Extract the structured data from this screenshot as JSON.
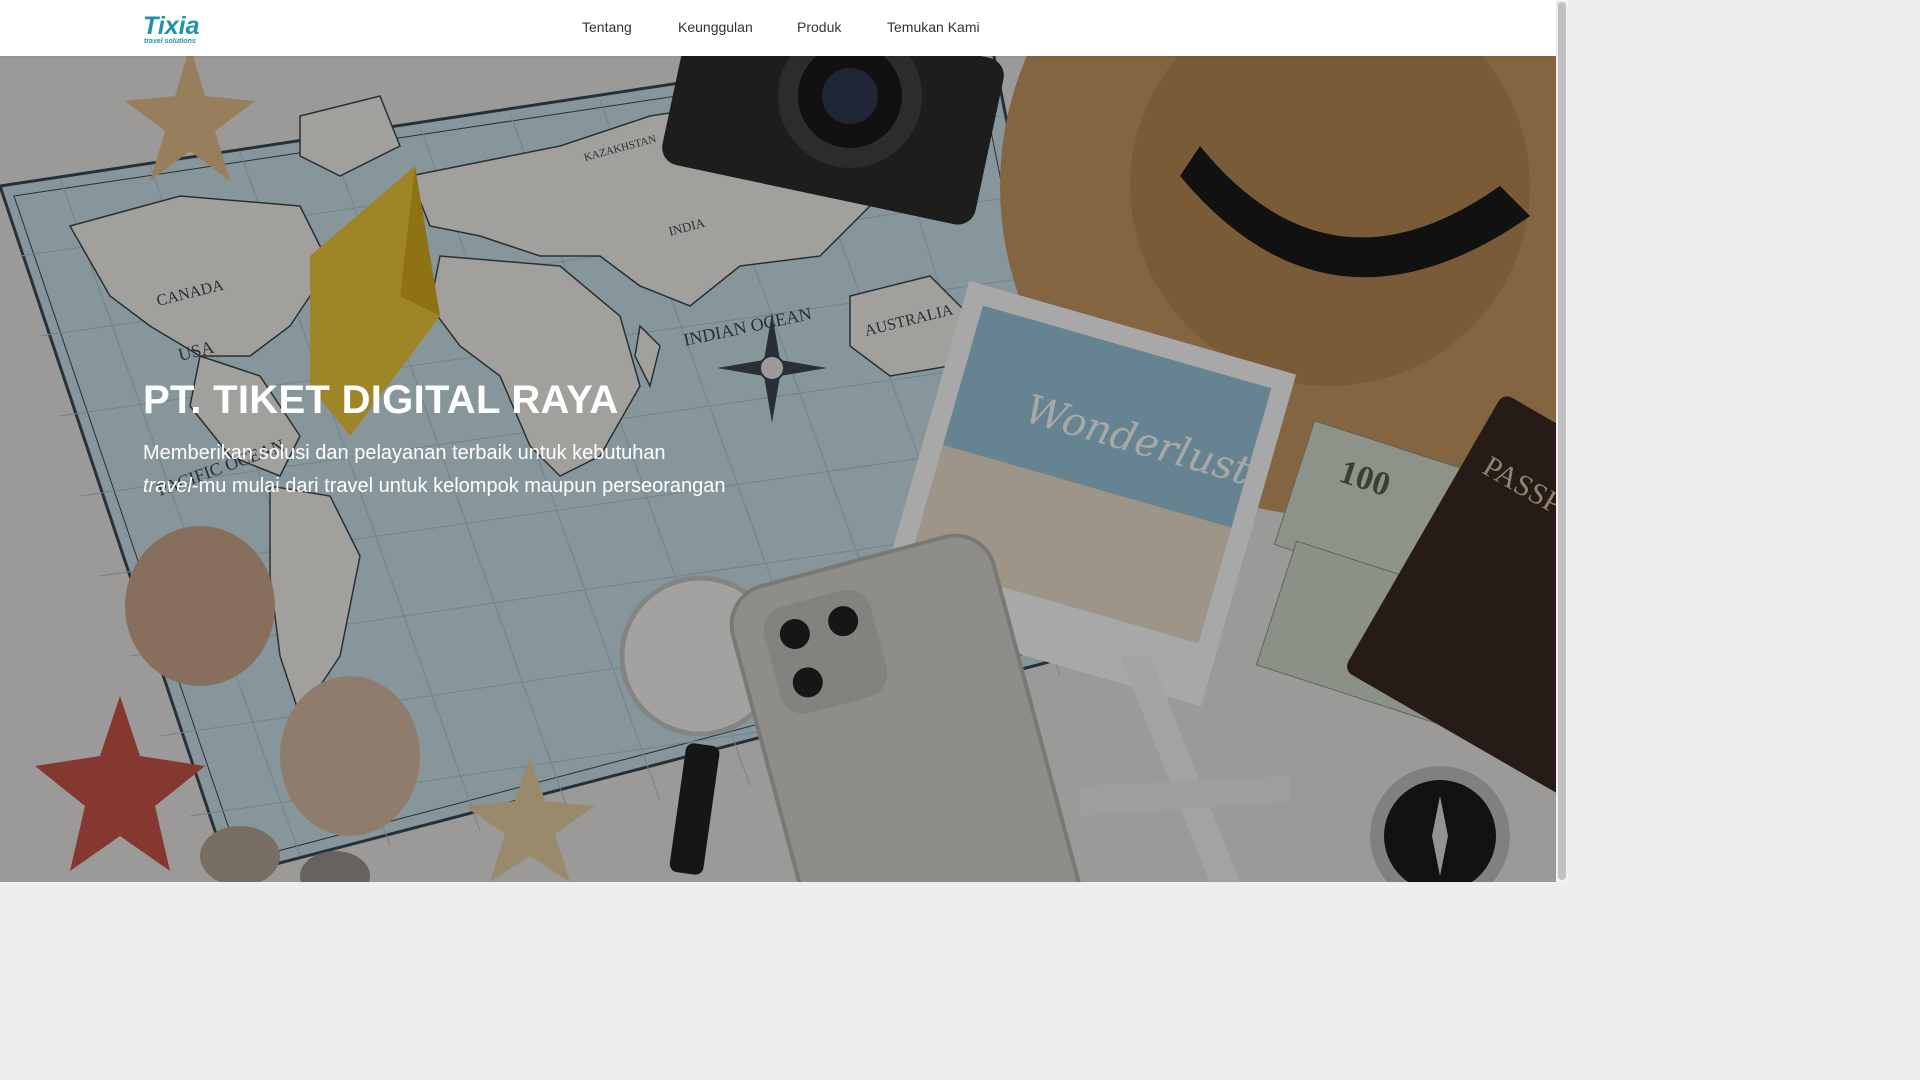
{
  "brand": {
    "logo_text": "Tixia",
    "logo_tagline": "travel solutions",
    "logo_color": "#1f93a8"
  },
  "nav": {
    "items": [
      {
        "label": "Tentang"
      },
      {
        "label": "Keunggulan"
      },
      {
        "label": "Produk"
      },
      {
        "label": "Temukan Kami"
      }
    ]
  },
  "hero": {
    "title": "PT. TIKET DIGITAL RAYA",
    "subtitle_line1": "Memberikan solusi dan pelayanan terbaik untuk kebutuhan",
    "subtitle_line2_em": "travel",
    "subtitle_line2_rest": "-mu mulai dari travel untuk kelompok maupun perseorangan",
    "photo_labels": {
      "passport": "PASSPORT",
      "postcard": "Wonderlust",
      "banknote": "100",
      "map_indian_ocean": "INDIAN OCEAN",
      "map_australia": "AUSTRALIA",
      "map_canada": "CANADA",
      "map_usa": "USA",
      "map_pacific_ocean": "PACIFIC OCEAN",
      "map_india": "INDIA",
      "map_kazakhstan": "KAZAKHSTAN"
    }
  }
}
